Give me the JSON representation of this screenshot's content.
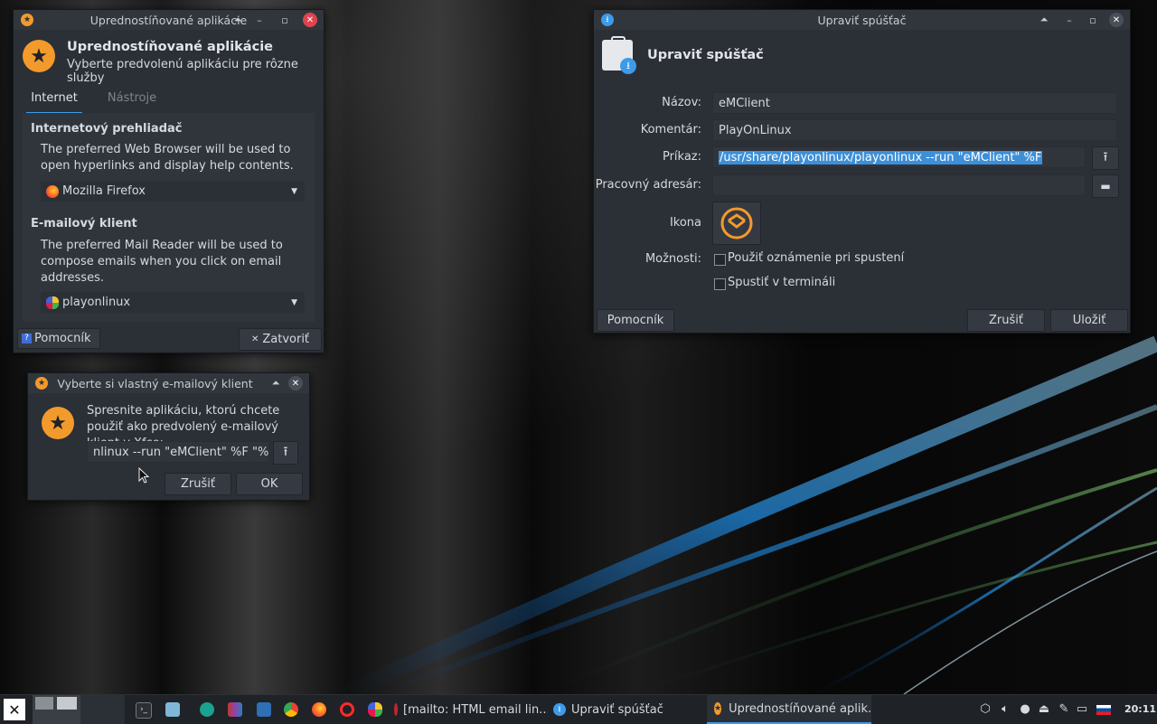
{
  "pref_window": {
    "title": "Uprednostíňované aplikácie",
    "heading": "Uprednostíňované aplikácie",
    "subheading": "Vyberte predvolenú aplikáciu pre rôzne služby",
    "tabs": [
      "Internet",
      "Nástroje"
    ],
    "browser_section": {
      "title": "Internetový prehliadač",
      "desc": "The preferred Web Browser will be used to open hyperlinks and display help contents.",
      "selected": "Mozilla Firefox"
    },
    "mail_section": {
      "title": "E-mailový klient",
      "desc": "The preferred Mail Reader will be used to compose emails when you click on email addresses.",
      "selected": "playonlinux"
    },
    "help_label": "Pomocník",
    "close_label": "Zatvoriť"
  },
  "custom_dialog": {
    "title": "Vyberte si vlastný e-mailový klient",
    "message": "Spresnite aplikáciu, ktorú chcete použiť ako predvolený e-mailový klient v Xfce:",
    "command_value": "nlinux --run \"eMClient\" %F \"%s\"",
    "cancel_label": "Zrušiť",
    "ok_label": "OK"
  },
  "launcher_window": {
    "title": "Upraviť spúšťač",
    "heading": "Upraviť spúšťač",
    "fields": {
      "name_label": "Názov:",
      "name_value": "eMClient",
      "comment_label": "Komentár:",
      "comment_value": "PlayOnLinux",
      "command_label": "Príkaz:",
      "command_value": "/usr/share/playonlinux/playonlinux --run \"eMClient\" %F",
      "workdir_label": "Pracovný adresár:",
      "workdir_value": "",
      "icon_label": "Ikona",
      "options_label": "Možnosti:",
      "option_notify": "Použiť oznámenie pri spustení",
      "option_terminal": "Spustiť v termináli"
    },
    "help_label": "Pomocník",
    "cancel_label": "Zrušiť",
    "save_label": "Uložiť"
  },
  "taskbar": {
    "tasks": [
      "[mailto: HTML email lin...",
      "Upraviť spúšťač",
      "Uprednostíňované aplik..."
    ],
    "clock": "20:11"
  },
  "colors": {
    "accent": "#3d9be9",
    "selection": "#3d8fd8",
    "star_orange": "#f39a2c"
  }
}
